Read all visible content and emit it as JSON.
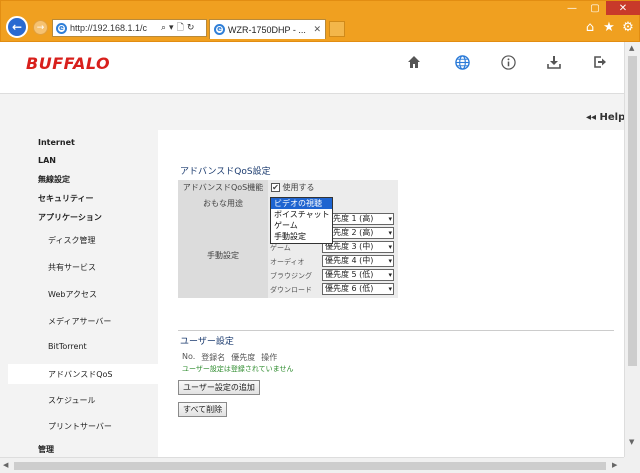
{
  "browser": {
    "address": "http://192.168.1.1/c",
    "tab_title": "WZR-1750DHP - ...",
    "address_buttons": [
      "⌕",
      "▾",
      "🗋",
      "↻"
    ]
  },
  "header": {
    "logo": "BUFFALO",
    "icons": [
      "home-icon",
      "globe-icon",
      "info-icon",
      "download-icon",
      "logout-icon"
    ]
  },
  "help_label": "Help",
  "sidebar": {
    "top_items": [
      "Internet",
      "LAN",
      "無線設定",
      "セキュリティー",
      "アプリケーション"
    ],
    "sub_items": [
      "ディスク管理",
      "共有サービス",
      "Webアクセス",
      "メディアサーバー",
      "BitTorrent",
      "アドバンスドQoS",
      "スケジュール",
      "プリントサーバー"
    ],
    "bottom_item": "管理",
    "active": "アドバンスドQoS"
  },
  "qos": {
    "section_title": "アドバンスドQoS設定",
    "feature_label": "アドバンスドQoS機能",
    "feature_checkbox_label": "使用する",
    "feature_enabled": true,
    "usage_label": "おもな用途",
    "manual_label": "手動設定",
    "categories": [
      "",
      "",
      "ゲーム",
      "オーディオ",
      "ブラウジング",
      "ダウンロード"
    ],
    "priorities": [
      "優先度 1 (高)",
      "優先度 2 (高)",
      "優先度 3 (中)",
      "優先度 4 (中)",
      "優先度 5 (低)",
      "優先度 6 (低)"
    ],
    "usage_options": [
      "ビデオの視聴",
      "ボイスチャット",
      "ゲーム",
      "手動設定"
    ],
    "usage_selected": "ビデオの視聴"
  },
  "user_settings": {
    "section_title": "ユーザー設定",
    "columns": [
      "No.",
      "登録名",
      "優先度",
      "操作"
    ],
    "empty_message": "ユーザー設定は登録されていません",
    "add_button": "ユーザー設定の追加",
    "delete_all_button": "すべて削除"
  }
}
